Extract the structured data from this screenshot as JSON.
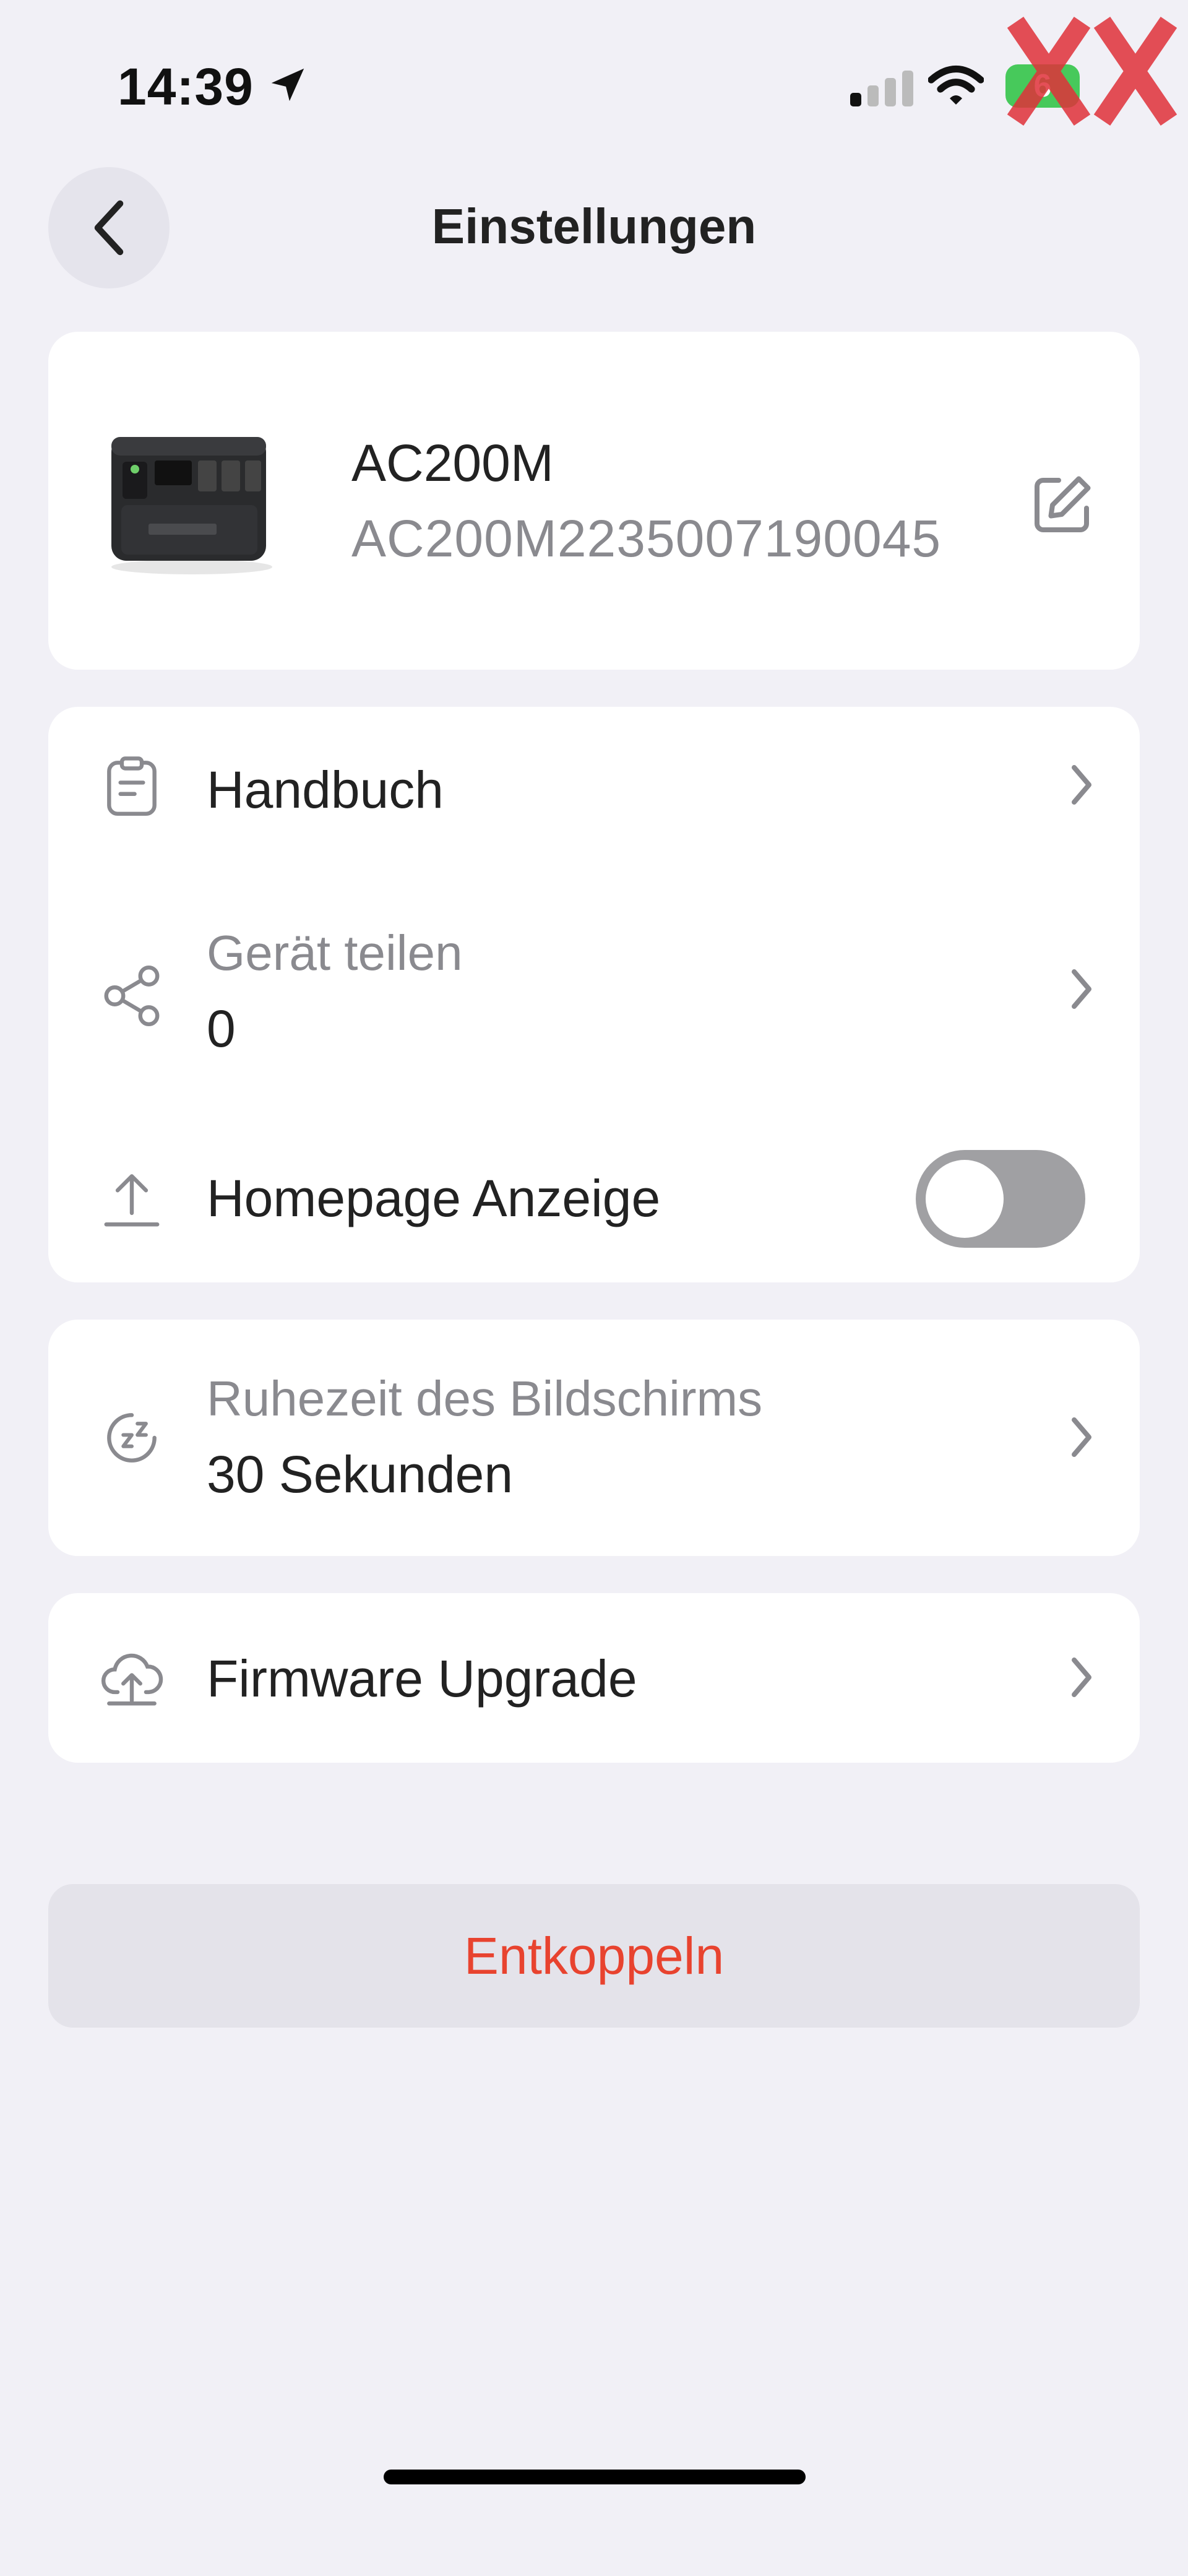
{
  "status_bar": {
    "time": "14:39",
    "battery": "6",
    "icons": [
      "location-arrow-icon",
      "cellular-signal-icon",
      "wifi-icon",
      "battery-icon"
    ]
  },
  "header": {
    "title": "Einstellungen",
    "back_icon": "chevron-left-icon"
  },
  "device": {
    "name": "AC200M",
    "serial": "AC200M2235007190045",
    "edit_icon": "edit-icon"
  },
  "settings": {
    "manual": {
      "label": "Handbuch",
      "icon": "clipboard-icon"
    },
    "share": {
      "label": "Gerät teilen",
      "value": "0",
      "icon": "share-icon"
    },
    "homepage": {
      "label": "Homepage Anzeige",
      "icon": "upload-icon",
      "enabled": false
    }
  },
  "screen": {
    "label": "Ruhezeit des Bildschirms",
    "value": "30 Sekunden",
    "icon": "sleep-timer-icon"
  },
  "firmware": {
    "label": "Firmware Upgrade",
    "icon": "cloud-upload-icon"
  },
  "unbind": {
    "label": "Entkoppeln",
    "color": "#e8432f"
  },
  "colors": {
    "background": "#f1f0f6",
    "card": "#ffffff",
    "toggle_off": "#a0a0a3",
    "battery": "#47c95b"
  }
}
